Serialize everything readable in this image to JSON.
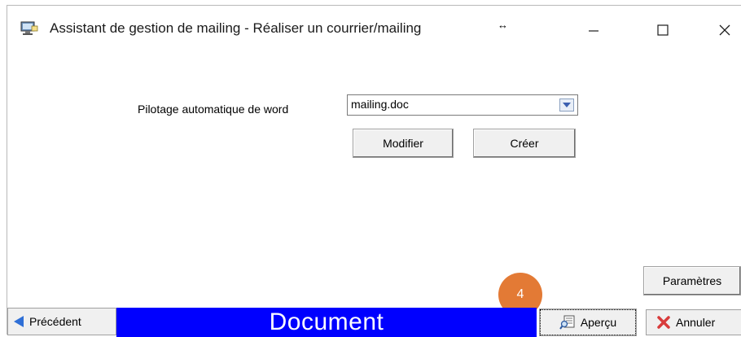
{
  "window": {
    "title": "Assistant de gestion de mailing - Réaliser un courrier/mailing",
    "resize_glyph": "↔",
    "icons": {
      "app": "mailing-app-icon",
      "minimize": "minimize-icon",
      "maximize": "maximize-icon",
      "close": "close-icon"
    }
  },
  "form": {
    "pilot_label": "Pilotage automatique de word",
    "document_select": {
      "value": "mailing.doc"
    },
    "modifier_label": "Modifier",
    "creer_label": "Créer",
    "parametres_label": "Paramètres"
  },
  "footer": {
    "previous_label": "Précédent",
    "banner_text": "Document",
    "banner_color": "#0000ff",
    "apercu_label": "Aperçu",
    "annuler_label": "Annuler"
  },
  "annotation": {
    "step_badge": "4",
    "badge_color": "#e37a35"
  }
}
